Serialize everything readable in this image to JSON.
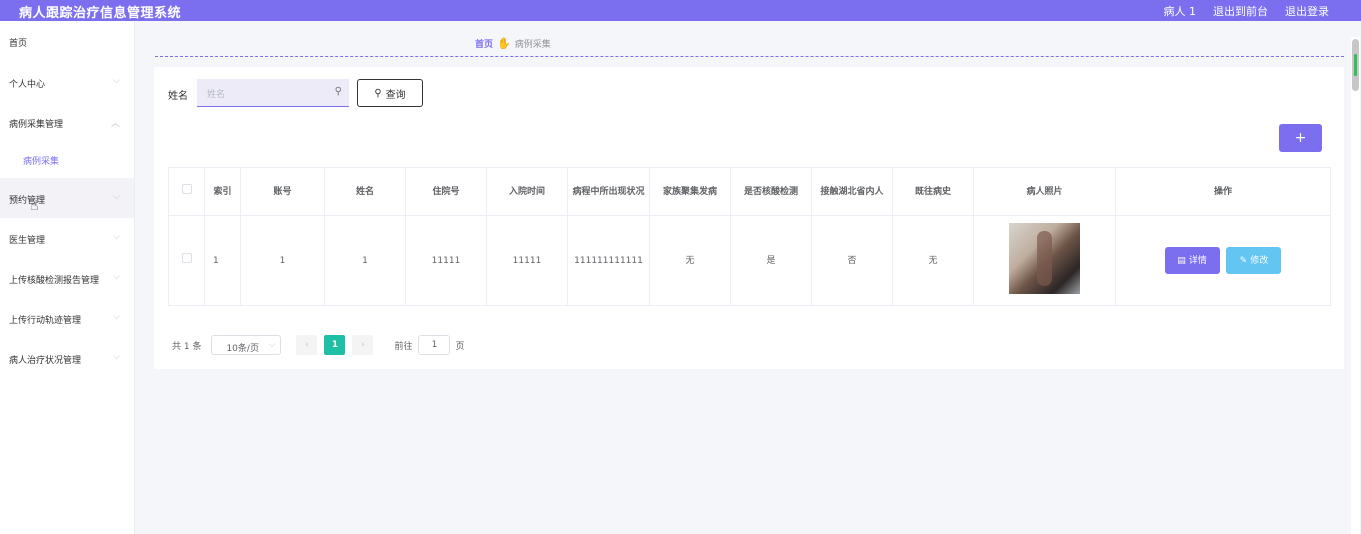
{
  "header": {
    "app_title": "病人跟踪治疗信息管理系统",
    "user": "病人 1",
    "back_to_front": "退出到前台",
    "logout": "退出登录"
  },
  "sidebar": {
    "items": [
      {
        "label": "首页"
      },
      {
        "label": "个人中心"
      },
      {
        "label": "病例采集管理"
      },
      {
        "label": "病例采集"
      },
      {
        "label": "预约管理"
      },
      {
        "label": "医生管理"
      },
      {
        "label": "上传核酸检测报告管理"
      },
      {
        "label": "上传行动轨迹管理"
      },
      {
        "label": "病人治疗状况管理"
      }
    ]
  },
  "breadcrumb": {
    "home": "首页",
    "current": "病例采集"
  },
  "search": {
    "label": "姓名",
    "placeholder": "姓名",
    "query_label": "查询"
  },
  "add_button": "+",
  "table": {
    "headers": [
      "索引",
      "账号",
      "姓名",
      "住院号",
      "入院时间",
      "病程中所出现状况",
      "家族聚集发病",
      "是否核酸检测",
      "接触湖北省内人",
      "既往病史",
      "病人照片",
      "操作"
    ],
    "rows": [
      {
        "index": "1",
        "account": "1",
        "name": "1",
        "admission_no": "11111",
        "admission_time": "11111",
        "condition": "111111111111",
        "family_cluster": "无",
        "nucleic_test": "是",
        "hubei_contact": "否",
        "history": "无",
        "detail_label": "详情",
        "edit_label": "修改"
      }
    ]
  },
  "pagination": {
    "total": "共 1 条",
    "page_size": "10条/页",
    "current_page": "1",
    "goto_prefix": "前往",
    "goto_value": "1",
    "goto_suffix": "页"
  },
  "colors": {
    "accent": "#7b6ff0",
    "page_active": "#1fbfa6",
    "edit_button": "#63c5f2"
  }
}
